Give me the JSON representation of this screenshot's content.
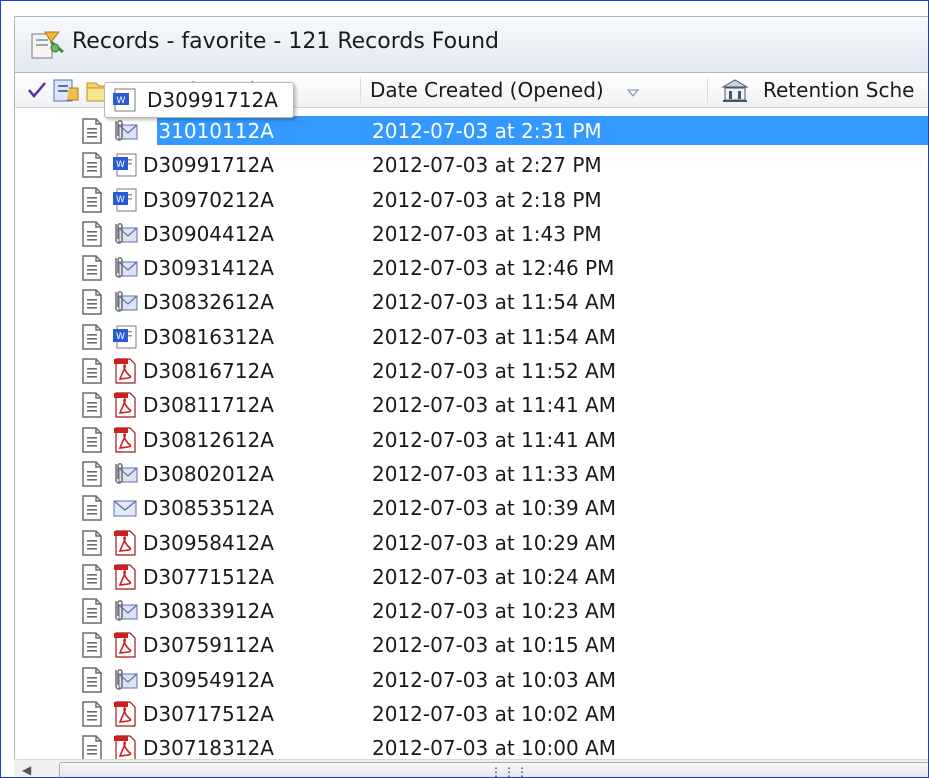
{
  "window": {
    "title": "Records - favorite - 121 Records Found"
  },
  "columns": {
    "record_number": "Record Number",
    "date_created": "Date Created (Opened)",
    "retention": "Retention Sche"
  },
  "tooltip": {
    "text": "D30991712A"
  },
  "rows": [
    {
      "number": "D31010112A",
      "date": "2012-07-03 at 2:31 PM",
      "type": "email-attachment",
      "selected": true
    },
    {
      "number": "D30991712A",
      "date": "2012-07-03 at 2:27 PM",
      "type": "word"
    },
    {
      "number": "D30970212A",
      "date": "2012-07-03 at 2:18 PM",
      "type": "word"
    },
    {
      "number": "D30904412A",
      "date": "2012-07-03 at 1:43 PM",
      "type": "email-attachment"
    },
    {
      "number": "D30931412A",
      "date": "2012-07-03 at 12:46 PM",
      "type": "email-attachment"
    },
    {
      "number": "D30832612A",
      "date": "2012-07-03 at 11:54 AM",
      "type": "email-attachment"
    },
    {
      "number": "D30816312A",
      "date": "2012-07-03 at 11:54 AM",
      "type": "word"
    },
    {
      "number": "D30816712A",
      "date": "2012-07-03 at 11:52 AM",
      "type": "pdf"
    },
    {
      "number": "D30811712A",
      "date": "2012-07-03 at 11:41 AM",
      "type": "pdf"
    },
    {
      "number": "D30812612A",
      "date": "2012-07-03 at 11:41 AM",
      "type": "pdf"
    },
    {
      "number": "D30802012A",
      "date": "2012-07-03 at 11:33 AM",
      "type": "email-attachment"
    },
    {
      "number": "D30853512A",
      "date": "2012-07-03 at 10:39 AM",
      "type": "email"
    },
    {
      "number": "D30958412A",
      "date": "2012-07-03 at 10:29 AM",
      "type": "pdf"
    },
    {
      "number": "D30771512A",
      "date": "2012-07-03 at 10:24 AM",
      "type": "pdf"
    },
    {
      "number": "D30833912A",
      "date": "2012-07-03 at 10:23 AM",
      "type": "email-attachment"
    },
    {
      "number": "D30759112A",
      "date": "2012-07-03 at 10:15 AM",
      "type": "pdf"
    },
    {
      "number": "D30954912A",
      "date": "2012-07-03 at 10:03 AM",
      "type": "email-attachment"
    },
    {
      "number": "D30717512A",
      "date": "2012-07-03 at 10:02 AM",
      "type": "pdf"
    },
    {
      "number": "D30718312A",
      "date": "2012-07-03 at 10:00 AM",
      "type": "pdf"
    }
  ],
  "colors": {
    "selection": "#3399ff",
    "frame_border": "#1d40d8",
    "pdf_red": "#cc1f1f",
    "word_blue": "#2a5bd7"
  }
}
